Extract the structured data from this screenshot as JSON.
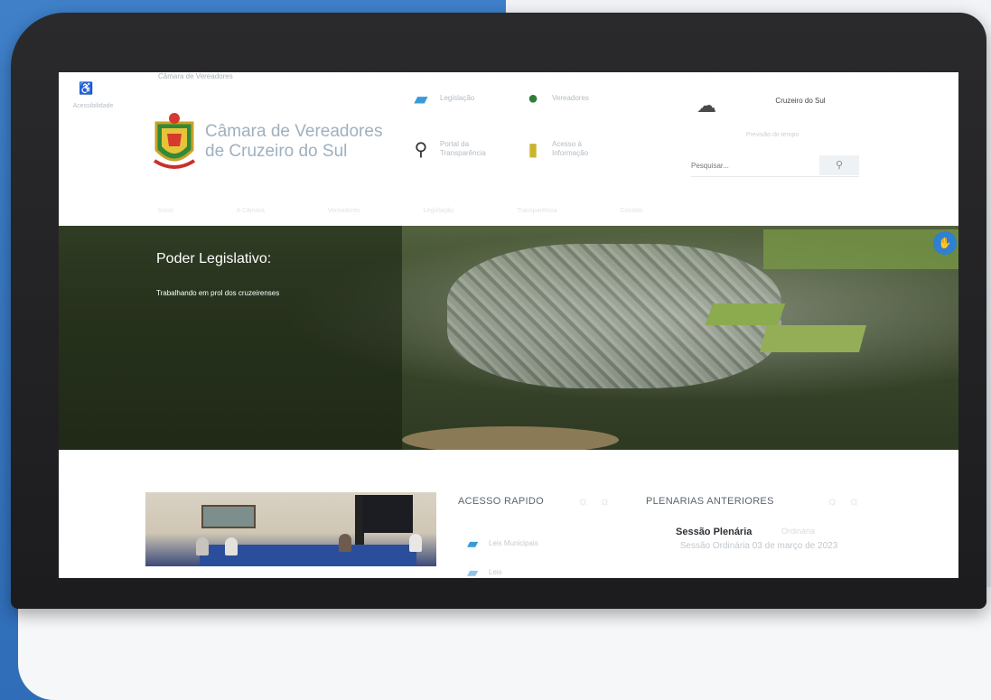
{
  "header": {
    "accessibility_label": "Acessibilidade",
    "top_text": "Câmara de Vereadores",
    "site_name": "Câmara de Vereadores de Cruzeiro do Sul",
    "quick_links": [
      {
        "label": "Legislação",
        "icon": "book-icon"
      },
      {
        "label": "Vereadores",
        "icon": "person-icon"
      },
      {
        "label": "Portal da Transparência",
        "icon": "magnifier-icon"
      },
      {
        "label": "Acesso à Informação",
        "icon": "info-icon"
      }
    ],
    "weather": {
      "icon": "cloud-rain-icon",
      "text": "Cruzeiro do Sul",
      "sub": "Previsão do tempo"
    },
    "search": {
      "placeholder": "Pesquisar...",
      "button_icon": "search-icon"
    },
    "nav": [
      "Início",
      "A Câmara",
      "Vereadores",
      "Legislação",
      "Transparência",
      "Contato"
    ]
  },
  "hero": {
    "title": "Poder Legislativo:",
    "subtitle": "Trabalhando em prol dos cruzeirenses"
  },
  "lower": {
    "quick_access_title": "ACESSO RAPIDO",
    "quick_access_items": [
      {
        "label": "Leis Municipais",
        "icon": "book-icon"
      },
      {
        "label": "Leis",
        "icon": "book-icon"
      }
    ],
    "plenaries_title": "PLENARIAS ANTERIORES",
    "plenary": {
      "title": "Sessão Plenária",
      "title_tail": "Ordinária",
      "subtitle": "Sessão Ordinária 03 de março de 2023"
    }
  },
  "colors": {
    "accent": "#2f7fd2",
    "backdrop": "#3f80c9"
  }
}
